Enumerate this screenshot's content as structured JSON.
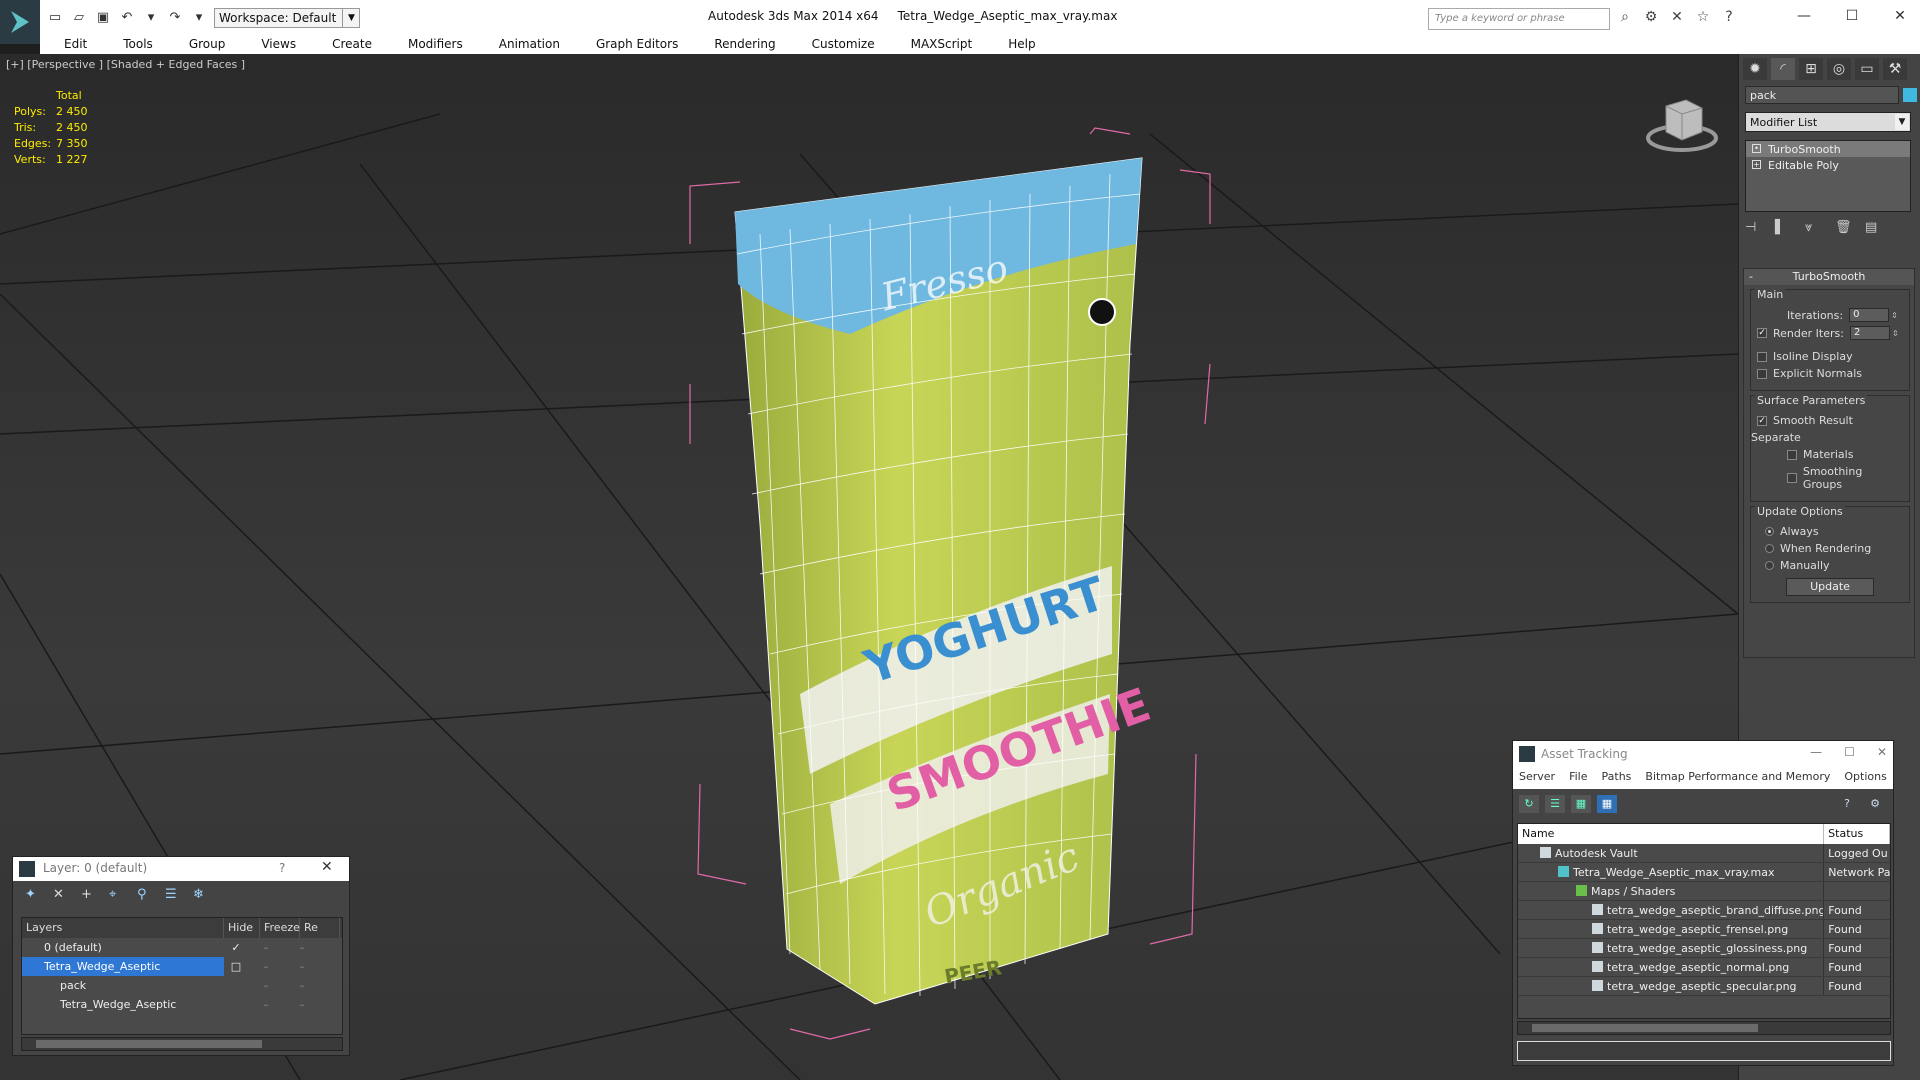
{
  "titlebar": {
    "app_title": "Autodesk 3ds Max  2014 x64",
    "file_title": "Tetra_Wedge_Aseptic_max_vray.max",
    "workspace": "Workspace: Default",
    "search_placeholder": "Type a keyword or phrase"
  },
  "menu": [
    "Edit",
    "Tools",
    "Group",
    "Views",
    "Create",
    "Modifiers",
    "Animation",
    "Graph Editors",
    "Rendering",
    "Customize",
    "MAXScript",
    "Help"
  ],
  "viewport": {
    "label": "[+] [Perspective ] [Shaded + Edged Faces ]",
    "stats_header": "Total",
    "stats": [
      {
        "label": "Polys:",
        "value": "2 450"
      },
      {
        "label": "Tris:",
        "value": "2 450"
      },
      {
        "label": "Edges:",
        "value": "7 350"
      },
      {
        "label": "Verts:",
        "value": "1 227"
      }
    ],
    "pack_text": {
      "top": "Fresso",
      "mid1": "YOGHURT",
      "mid2": "SMOOTHIE",
      "bottom": "Organic",
      "small": "PEER"
    }
  },
  "command_panel": {
    "object_name": "pack",
    "object_color": "#3fb9e0",
    "modifier_list": "Modifier List",
    "stack": [
      "TurboSmooth",
      "Editable Poly"
    ],
    "rollout_title": "TurboSmooth",
    "main_label": "Main",
    "iterations_label": "Iterations:",
    "iterations_value": "0",
    "render_iters_label": "Render Iters:",
    "render_iters_value": "2",
    "isoline": "Isoline Display",
    "explicit_normals": "Explicit Normals",
    "surface_label": "Surface Parameters",
    "smooth_result": "Smooth Result",
    "separate_label": "Separate",
    "materials": "Materials",
    "smoothing_groups": "Smoothing Groups",
    "update_label": "Update Options",
    "always": "Always",
    "when_rendering": "When Rendering",
    "manually": "Manually",
    "update_btn": "Update"
  },
  "layer_dialog": {
    "title": "Layer: 0 (default)",
    "help": "?",
    "columns": [
      "Layers",
      "Hide",
      "Freeze",
      "Re"
    ],
    "rows": [
      {
        "name": "0 (default)",
        "check": "✓",
        "sel": false,
        "indent": 0
      },
      {
        "name": "Tetra_Wedge_Aseptic",
        "check": "□",
        "sel": true,
        "indent": 0
      },
      {
        "name": "pack",
        "check": "",
        "sel": false,
        "indent": 1
      },
      {
        "name": "Tetra_Wedge_Aseptic",
        "check": "",
        "sel": false,
        "indent": 1
      }
    ]
  },
  "asset_dialog": {
    "title": "Asset Tracking",
    "menu": [
      "Server",
      "File",
      "Paths",
      "Bitmap Performance and Memory",
      "Options"
    ],
    "columns": [
      "Name",
      "Status"
    ],
    "rows": [
      {
        "name": "Autodesk Vault",
        "status": "Logged Ou",
        "indent": 1
      },
      {
        "name": "Tetra_Wedge_Aseptic_max_vray.max",
        "status": "Network Pa",
        "indent": 2
      },
      {
        "name": "Maps / Shaders",
        "status": "",
        "indent": 3
      },
      {
        "name": "tetra_wedge_aseptic_brand_diffuse.png",
        "status": "Found",
        "indent": 4
      },
      {
        "name": "tetra_wedge_aseptic_frensel.png",
        "status": "Found",
        "indent": 4
      },
      {
        "name": "tetra_wedge_aseptic_glossiness.png",
        "status": "Found",
        "indent": 4
      },
      {
        "name": "tetra_wedge_aseptic_normal.png",
        "status": "Found",
        "indent": 4
      },
      {
        "name": "tetra_wedge_aseptic_specular.png",
        "status": "Found",
        "indent": 4
      }
    ]
  }
}
